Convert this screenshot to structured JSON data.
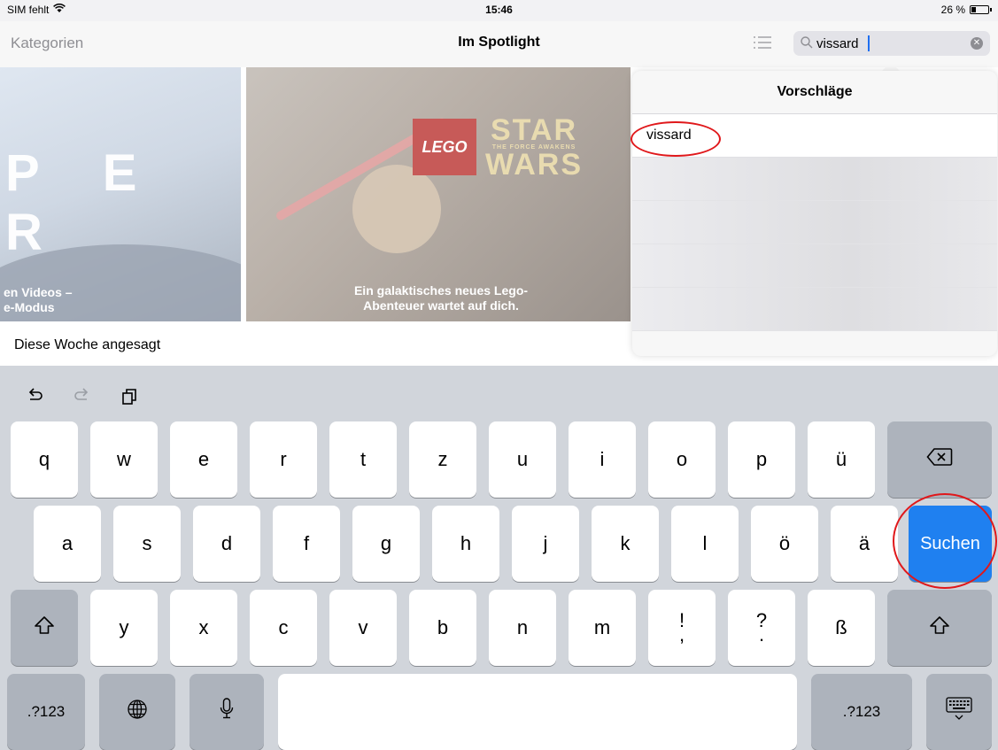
{
  "status": {
    "carrier": "SIM fehlt",
    "time": "15:46",
    "battery_text": "26 %",
    "battery_level": 0.26
  },
  "nav": {
    "back_label": "Kategorien",
    "title": "Im Spotlight"
  },
  "search": {
    "value": "vissard",
    "placeholder": ""
  },
  "banners": [
    {
      "big_text": "P E R",
      "caption_line1": "en Videos –",
      "caption_line2": "e-Modus"
    },
    {
      "logo": "LEGO",
      "title1": "STAR",
      "title_sub": "THE FORCE AWAKENS",
      "title2": "WARS",
      "caption_line1": "Ein galaktisches neues Lego-",
      "caption_line2": "Abenteuer wartet auf dich."
    }
  ],
  "section_title": "Diese Woche angesagt",
  "suggestions": {
    "header": "Vorschläge",
    "items": [
      "vissard"
    ]
  },
  "keyboard": {
    "row1": [
      "q",
      "w",
      "e",
      "r",
      "t",
      "z",
      "u",
      "i",
      "o",
      "p",
      "ü"
    ],
    "row2": [
      "a",
      "s",
      "d",
      "f",
      "g",
      "h",
      "j",
      "k",
      "l",
      "ö",
      "ä"
    ],
    "row3": [
      "y",
      "x",
      "c",
      "v",
      "b",
      "n",
      "m"
    ],
    "punct1_top": "!",
    "punct1_bottom": ",",
    "punct2_top": "?",
    "punct2_bottom": ".",
    "eszett": "ß",
    "search_key": "Suchen",
    "numbers_key": ".?123",
    "icons": {
      "undo": "undo-icon",
      "redo": "redo-icon",
      "paste": "paste-icon",
      "delete": "delete-icon",
      "shift": "shift-icon",
      "globe": "globe-icon",
      "mic": "microphone-icon",
      "hide": "keyboard-hide-icon"
    }
  },
  "colors": {
    "accent": "#1f80f0",
    "annotation": "#e0181b"
  }
}
